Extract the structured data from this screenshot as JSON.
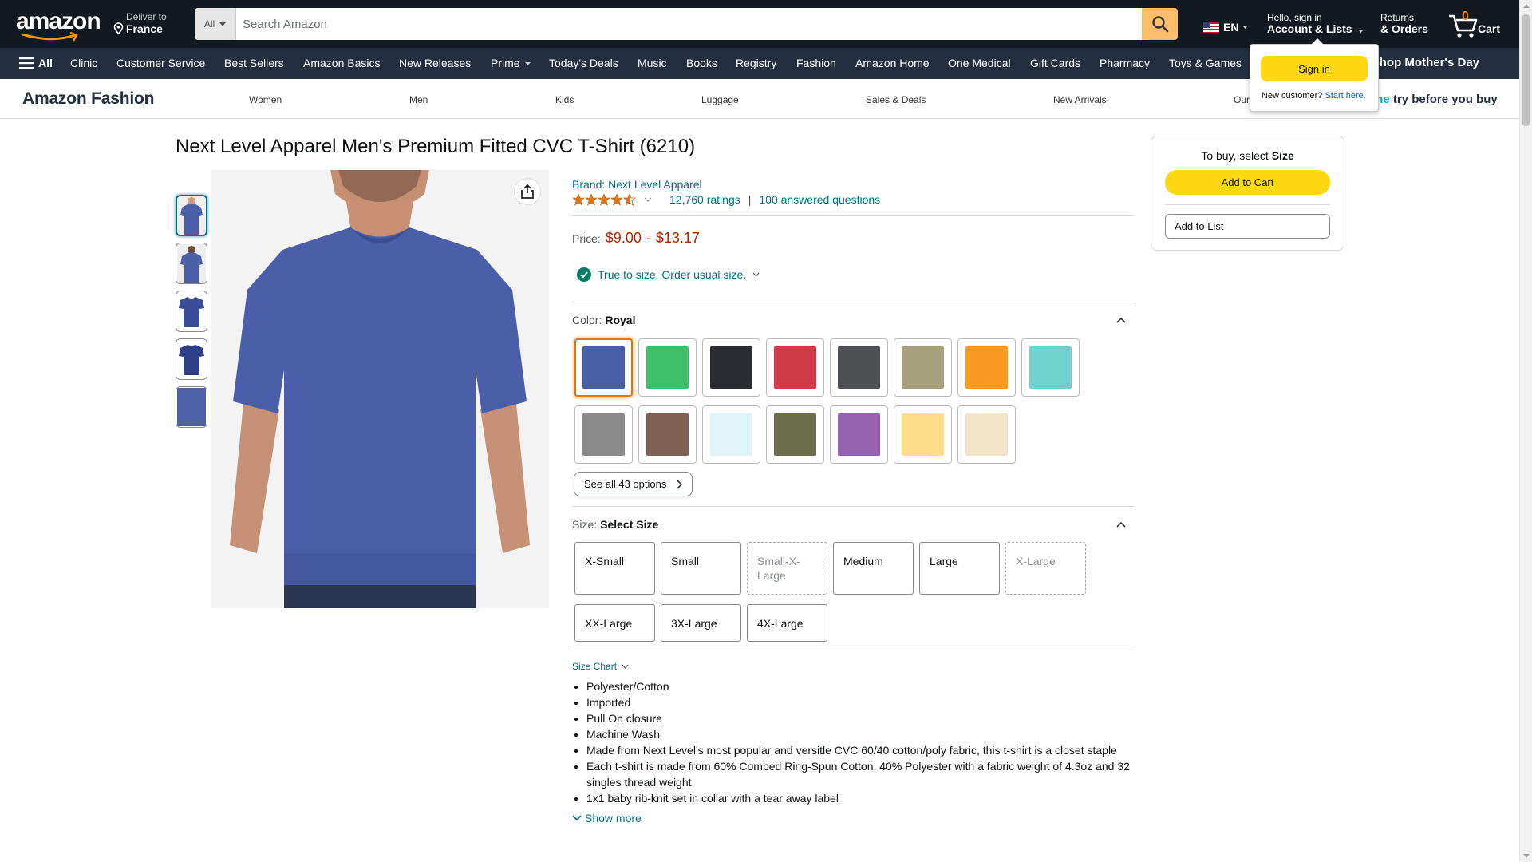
{
  "header": {
    "logo_text": "amazon",
    "deliver_line1": "Deliver to",
    "deliver_line2": "France",
    "search_category": "All",
    "search_placeholder": "Search Amazon",
    "language": "EN",
    "account_line1": "Hello, sign in",
    "account_line2": "Account & Lists",
    "returns_line1": "Returns",
    "returns_line2": "& Orders",
    "cart_count": "0",
    "cart_label": "Cart"
  },
  "subnav": {
    "all_label": "All",
    "items": [
      "Clinic",
      "Customer Service",
      "Best Sellers",
      "Amazon Basics",
      "New Releases",
      "Prime",
      "Today's Deals",
      "Music",
      "Books",
      "Registry",
      "Fashion",
      "Amazon Home",
      "One Medical",
      "Gift Cards",
      "Pharmacy",
      "Toys & Games"
    ],
    "promo": "Shop Mother's Day"
  },
  "fashion_nav": {
    "title": "Amazon Fashion",
    "links": [
      "Women",
      "Men",
      "Kids",
      "Luggage",
      "Sales & Deals",
      "New Arrivals",
      "Our"
    ],
    "try_prefix": "me",
    "try_suffix": " try before you buy"
  },
  "signin_flyout": {
    "button": "Sign in",
    "new_customer": "New customer?",
    "start_here": "Start here."
  },
  "product": {
    "title": "Next Level Apparel Men's Premium Fitted CVC T-Shirt (6210)",
    "brand": "Brand: Next Level Apparel",
    "rating_stars": 4.5,
    "ratings": "12,760 ratings",
    "sep": "|",
    "answered": "100 answered questions",
    "price_label": "Price:",
    "price_low": "$9.00",
    "price_dash": "-",
    "price_high": "$13.17",
    "fit_text": "True to size. Order usual size.",
    "color_key": "Color:",
    "color_value": "Royal",
    "colors": [
      {
        "name": "Royal",
        "hex": "#4a5fa8"
      },
      {
        "name": "Kelly Green",
        "hex": "#3fbf6a"
      },
      {
        "name": "Black",
        "hex": "#2b2c31"
      },
      {
        "name": "Red",
        "hex": "#cf3c47"
      },
      {
        "name": "Charcoal",
        "hex": "#4f5054"
      },
      {
        "name": "Stone",
        "hex": "#a6a07c"
      },
      {
        "name": "Orange",
        "hex": "#fb9a22"
      },
      {
        "name": "Turquoise",
        "hex": "#6fd2cc"
      },
      {
        "name": "Heather Gray",
        "hex": "#8a8a8a"
      },
      {
        "name": "Brown",
        "hex": "#7d6254"
      },
      {
        "name": "Ice Blue",
        "hex": "#dff4f6"
      },
      {
        "name": "Military Green",
        "hex": "#6b6d4b"
      },
      {
        "name": "Purple",
        "hex": "#9563ad"
      },
      {
        "name": "Banana",
        "hex": "#fedd8a"
      },
      {
        "name": "Cream",
        "hex": "#f3e5c9"
      }
    ],
    "see_all": "See all 43 options",
    "size_key": "Size:",
    "size_value": "Select Size",
    "sizes": [
      {
        "label": "X-Small",
        "available": true
      },
      {
        "label": "Small",
        "available": true
      },
      {
        "label": "Small-X-Large",
        "available": false
      },
      {
        "label": "Medium",
        "available": true
      },
      {
        "label": "Large",
        "available": true
      },
      {
        "label": "X-Large",
        "available": false
      },
      {
        "label": "XX-Large",
        "available": true
      },
      {
        "label": "3X-Large",
        "available": true
      },
      {
        "label": "4X-Large",
        "available": true
      }
    ],
    "size_chart": "Size Chart",
    "bullets": [
      "Polyester/Cotton",
      "Imported",
      "Pull On closure",
      "Machine Wash",
      "Made from Next Level's most popular and versitle CVC 60/40 cotton/poly fabric, this t-shirt is a closet staple",
      "Each t-shirt is made from 60% Combed Ring-Spun Cotton, 40% Polyester with a fabric weight of 4.3oz and 32 singles thread weight",
      "1x1 baby rib-knit set in collar with a tear away label"
    ],
    "show_more": "Show more"
  },
  "buybox": {
    "select_prefix": "To buy, select ",
    "select_bold": "Size",
    "add_to_cart": "Add to Cart",
    "add_to_list": "Add to List"
  }
}
